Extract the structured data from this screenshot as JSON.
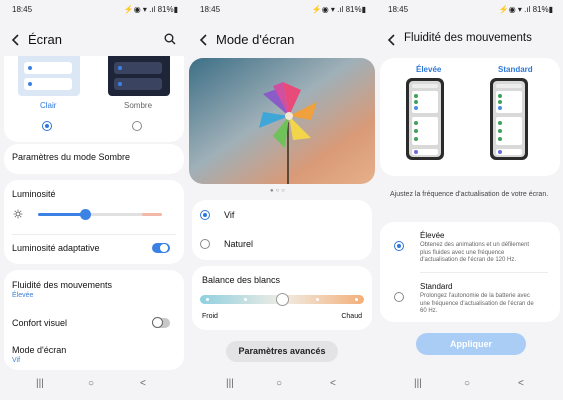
{
  "screens": [
    {
      "status": {
        "time": "18:45",
        "right": "⚡◉ ▾ .ıl 81%▮"
      },
      "title": "Écran",
      "theme_light": "Clair",
      "theme_dark": "Sombre",
      "dark_mode_settings": "Paramètres du mode Sombre",
      "brightness": "Luminosité",
      "adaptive_brightness": "Luminosité adaptative",
      "motion_smoothness": "Fluidité des mouvements",
      "motion_smoothness_value": "Élevée",
      "eye_comfort": "Confort visuel",
      "screen_mode": "Mode d'écran",
      "screen_mode_value": "Vif",
      "brightness_level": 0.38
    },
    {
      "status": {
        "time": "18:45",
        "right": "⚡◉ ▾ .ıl 81%▮"
      },
      "title": "Mode d'écran",
      "opt_vivid": "Vif",
      "opt_natural": "Naturel",
      "white_balance": "Balance des blancs",
      "cold": "Froid",
      "warm": "Chaud",
      "advanced": "Paramètres avancés",
      "white_balance_level": 0.5
    },
    {
      "status": {
        "time": "18:45",
        "right": "⚡◉ ▾ .ıl 81%▮"
      },
      "title": "Fluidité des mouvements",
      "preview_high": "Élevée",
      "preview_standard": "Standard",
      "intro": "Ajustez la fréquence d'actualisation de votre écran.",
      "high_title": "Élevée",
      "high_desc": "Obtenez des animations et un défilement plus fluides avec une fréquence d'actualisation de l'écran de 120 Hz.",
      "standard_title": "Standard",
      "standard_desc": "Prolongez l'autonomie de la batterie avec une fréquence d'actualisation de l'écran de 60 Hz.",
      "apply": "Appliquer"
    }
  ],
  "colors": {
    "accent": "#3b82e4",
    "apply_button": "#a9cdf5"
  },
  "nav": {
    "recents": "|||",
    "home": "○",
    "back": "<"
  }
}
